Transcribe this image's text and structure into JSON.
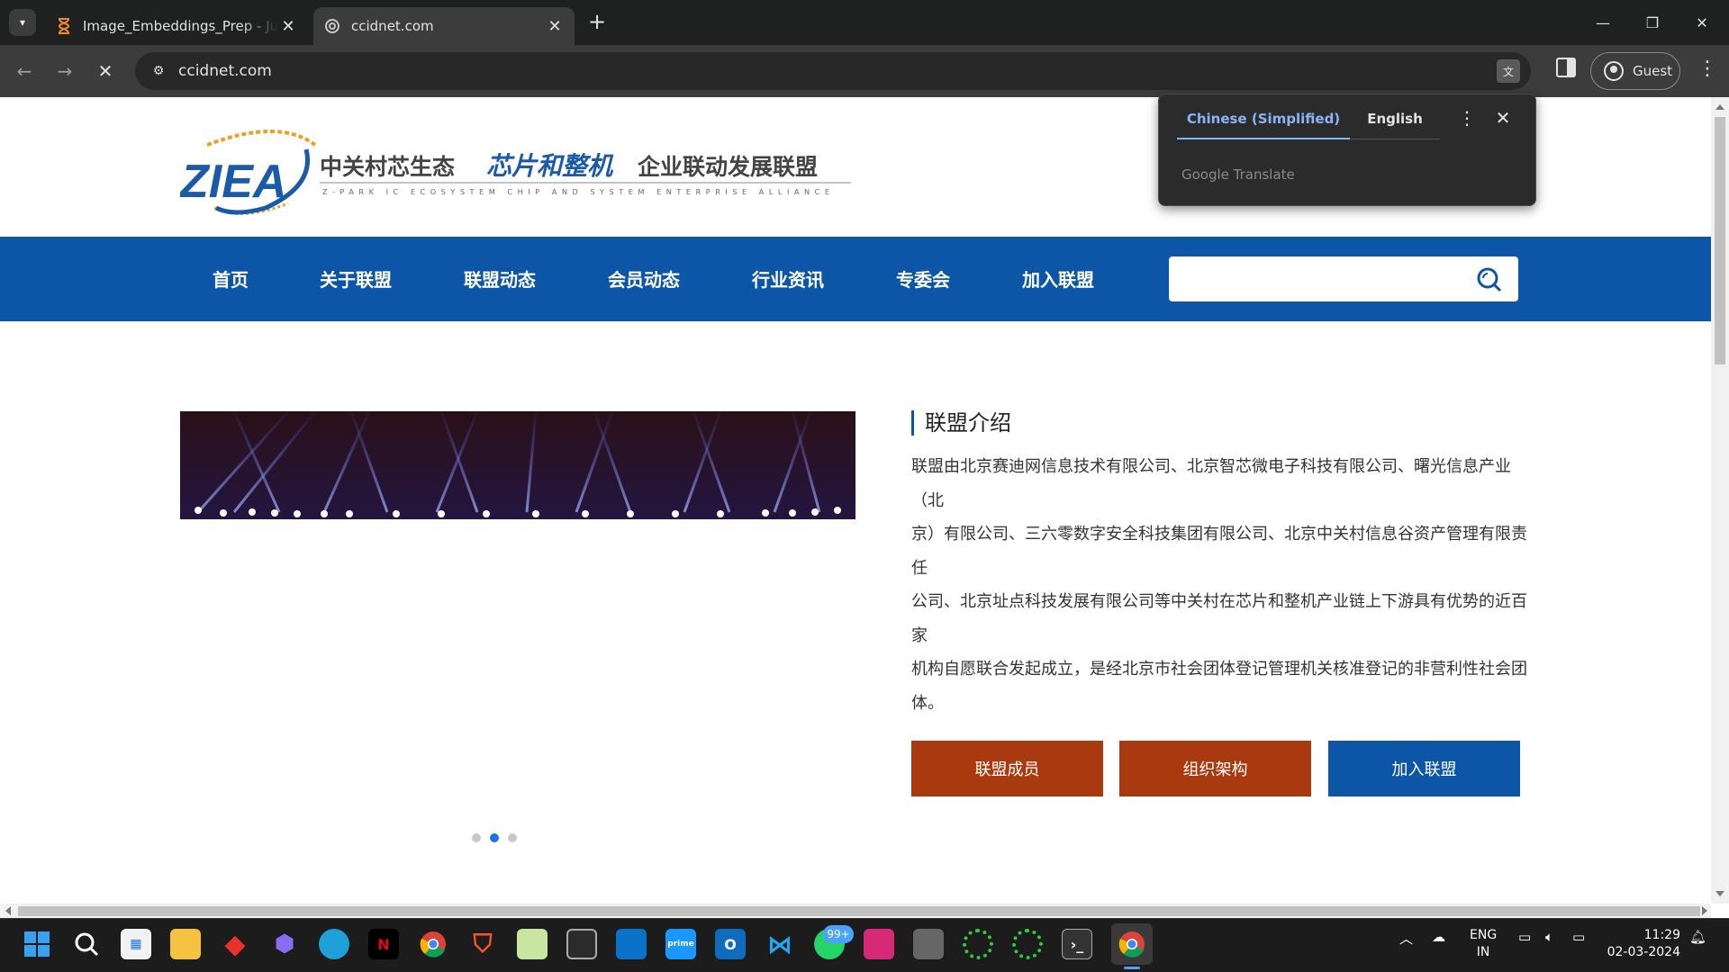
{
  "browser": {
    "tabs": [
      {
        "title": "Image_Embeddings_Prep - Jupyter",
        "active": false
      },
      {
        "title": "ccidnet.com",
        "active": true
      }
    ],
    "new_tab": "+",
    "window_controls": {
      "minimize": "—",
      "restore": "❐",
      "close": "✕"
    },
    "url": "ccidnet.com",
    "profile_label": "Guest",
    "tab_close": "✕"
  },
  "translate_popup": {
    "source_lang": "Chinese (Simplified)",
    "target_lang": "English",
    "more": "⋮",
    "close": "✕",
    "footer": "Google Translate"
  },
  "site": {
    "logo": {
      "abbr": "ZIEA",
      "cn_prefix": "中关村芯生态",
      "cn_highlight": "芯片和整机",
      "cn_suffix": "企业联动发展联盟",
      "en_sub": "Z-PARK IC ECOSYSTEM CHIP AND SYSTEM ENTERPRISE ALLIANCE"
    },
    "nav": [
      "首页",
      "关于联盟",
      "联盟动态",
      "会员动态",
      "行业资讯",
      "专委会",
      "加入联盟"
    ],
    "search_placeholder": "",
    "carousel": {
      "dot_count": 3,
      "active_index": 1
    },
    "section_title": "联盟介绍",
    "intro_lines": [
      "联盟由北京赛迪网信息技术有限公司、北京智芯微电子科技有限公司、曙光信息产业（北",
      "京）有限公司、三六零数字安全科技集团有限公司、北京中关村信息谷资产管理有限责任",
      "公司、北京址点科技发展有限公司等中关村在芯片和整机产业链上下游具有优势的近百家",
      "机构自愿联合发起成立，是经北京市社会团体登记管理机关核准登记的非营利性社会团",
      "体。"
    ],
    "buttons": [
      "联盟成员",
      "组织架构",
      "加入联盟"
    ],
    "colors": {
      "nav_blue": "#0d55a6",
      "btn_red": "#a93a0f",
      "logo_orange": "#f0a020"
    }
  },
  "taskbar": {
    "badge": "99+",
    "lang_line1": "ENG",
    "lang_line2": "IN",
    "time": "11:29",
    "date": "02-03-2024",
    "apps": [
      "start-icon",
      "search-icon",
      "store-icon",
      "file-explorer-icon",
      "git-icon",
      "copilot-icon",
      "edge-icon",
      "netflix-icon",
      "chrome-icon",
      "brave-icon",
      "notepad-plus-icon",
      "terminal-icon",
      "windows-icon",
      "prime-video-icon",
      "outlook-icon",
      "vscode-icon",
      "whatsapp-icon",
      "instagram-icon",
      "console-icon",
      "spinner-app-icon",
      "spinner-app2-icon",
      "powershell-icon",
      "chrome-active-icon"
    ]
  }
}
